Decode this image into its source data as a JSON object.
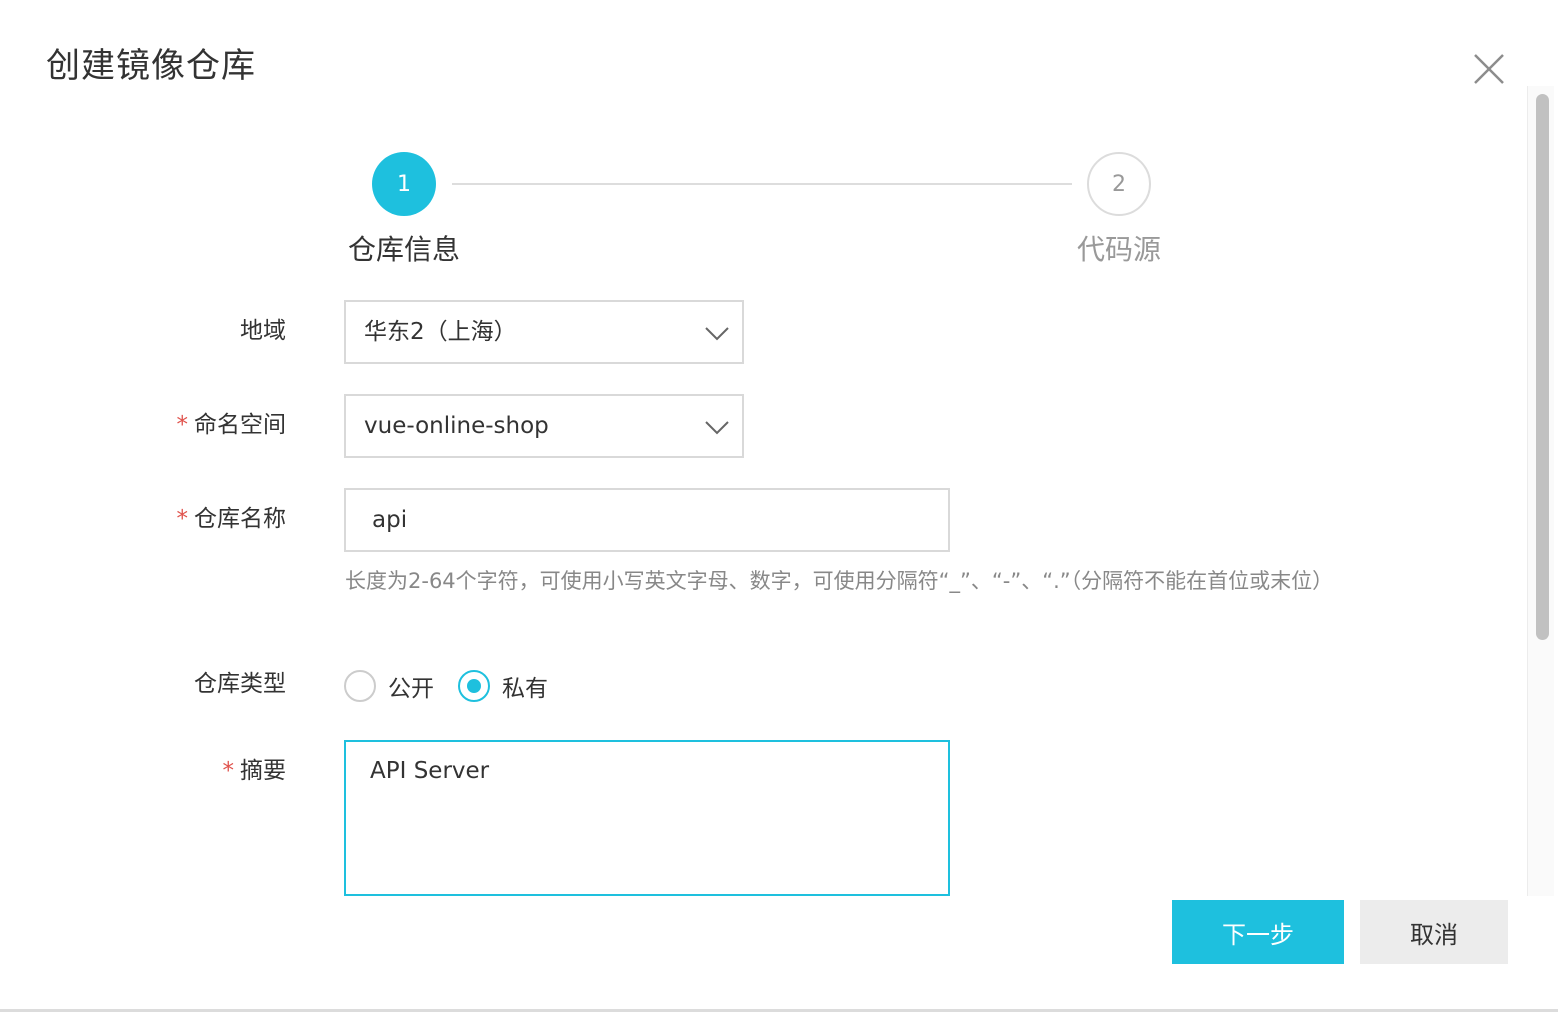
{
  "dialog": {
    "title": "创建镜像仓库"
  },
  "colors": {
    "accent": "#1ec0de",
    "required": "#e0524c",
    "border": "#d9d9d9",
    "muted_text": "#999999"
  },
  "icons": {
    "close": "close-icon",
    "chevron": "chevron-down-icon"
  },
  "steps": [
    {
      "number": "1",
      "label": "仓库信息",
      "active": true
    },
    {
      "number": "2",
      "label": "代码源",
      "active": false
    }
  ],
  "form": {
    "required_mark": "*",
    "region": {
      "label": "地域",
      "value": "华东2（上海）"
    },
    "namespace": {
      "label": "命名空间",
      "value": "vue-online-shop"
    },
    "repo_name": {
      "label": "仓库名称",
      "value": "api",
      "help": "长度为2-64个字符，可使用小写英文字母、数字，可使用分隔符“_”、“-”、“.”（分隔符不能在首位或末位）"
    },
    "repo_type": {
      "label": "仓库类型",
      "options": [
        {
          "label": "公开",
          "checked": false
        },
        {
          "label": "私有",
          "checked": true
        }
      ]
    },
    "summary": {
      "label": "摘要",
      "value": "API Server"
    }
  },
  "buttons": {
    "next": "下一步",
    "cancel": "取消"
  }
}
